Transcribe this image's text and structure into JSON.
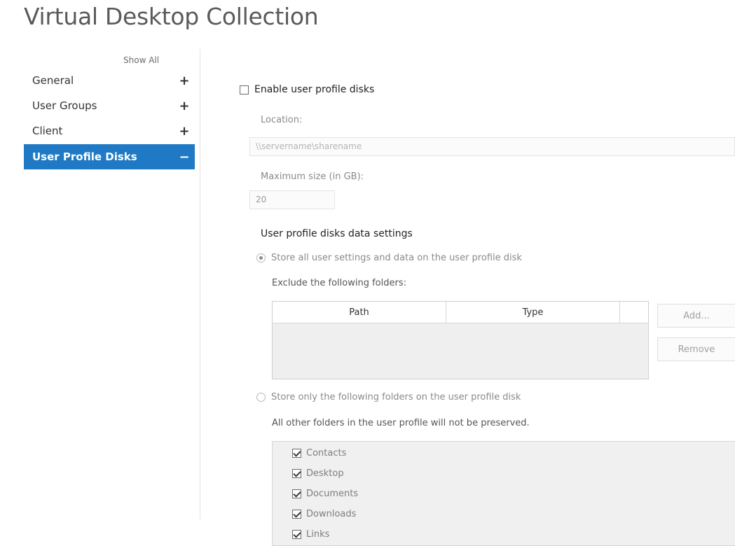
{
  "page": {
    "title": "Virtual Desktop Collection"
  },
  "nav": {
    "show_all": "Show All",
    "items": [
      {
        "label": "General",
        "sign": "+",
        "selected": false
      },
      {
        "label": "User Groups",
        "sign": "+",
        "selected": false
      },
      {
        "label": "Client",
        "sign": "+",
        "selected": false
      },
      {
        "label": "User Profile Disks",
        "sign": "−",
        "selected": true
      }
    ]
  },
  "settings": {
    "enable_label": "Enable user profile disks",
    "enable_checked": false,
    "location_label": "Location:",
    "location_placeholder": "\\\\servername\\sharename",
    "max_size_label": "Maximum size (in GB):",
    "max_size_value": "20",
    "section_title": "User profile disks data settings",
    "store_all_label": "Store all user settings and data on the user profile disk",
    "store_all_selected": true,
    "exclude_label": "Exclude the following folders:",
    "table_columns": [
      "Path",
      "Type",
      ""
    ],
    "add_button": "Add...",
    "remove_button": "Remove",
    "store_only_label": "Store only the following folders on the user profile disk",
    "store_only_selected": false,
    "not_preserved_label": "All other folders in the user profile will not be preserved.",
    "folders": [
      {
        "label": "Contacts",
        "checked": true
      },
      {
        "label": "Desktop",
        "checked": true
      },
      {
        "label": "Documents",
        "checked": true
      },
      {
        "label": "Downloads",
        "checked": true
      },
      {
        "label": "Links",
        "checked": true
      }
    ]
  }
}
